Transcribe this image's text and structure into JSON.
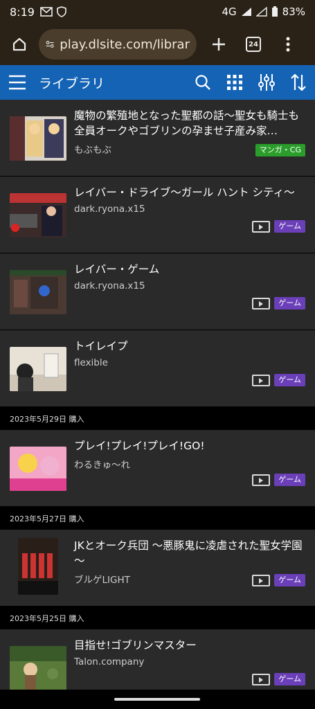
{
  "status": {
    "time": "8:19",
    "network": "4G",
    "battery": "83%"
  },
  "browser": {
    "url": "play.dlsite.com/librar",
    "tab_count": "24"
  },
  "appbar": {
    "title": "ライブラリ"
  },
  "items": [
    {
      "title": "魔物の繁殖地となった聖都の話～聖女も騎士も全員オークやゴブリンの孕ませ子産み家…",
      "author": "もぶもぶ",
      "tag": "マンガ・CG",
      "tag_type": "manga",
      "has_pc": false
    },
    {
      "title": "レイバー・ドライブ～ガール ハント シティ～",
      "author": "dark.ryona.x15",
      "tag": "ゲーム",
      "tag_type": "game",
      "has_pc": true
    },
    {
      "title": "レイバー・ゲーム",
      "author": "dark.ryona.x15",
      "tag": "ゲーム",
      "tag_type": "game",
      "has_pc": true
    },
    {
      "title": "トイレイプ",
      "author": "flexible",
      "tag": "ゲーム",
      "tag_type": "game",
      "has_pc": true
    },
    {
      "title": "プレイ!プレイ!プレイ!GO!",
      "author": "わるきゅ～れ",
      "tag": "ゲーム",
      "tag_type": "game",
      "has_pc": true
    },
    {
      "title": "JKとオーク兵団 ～悪豚鬼に凌虐された聖女学園～",
      "author": "ブルゲLIGHT",
      "tag": "ゲーム",
      "tag_type": "game",
      "has_pc": true
    },
    {
      "title": "目指せ!ゴブリンマスター",
      "author": "Talon.company",
      "tag": "ゲーム",
      "tag_type": "game",
      "has_pc": true
    }
  ],
  "dates": [
    "2023年5月29日 購入",
    "2023年5月27日 購入",
    "2023年5月25日 購入"
  ],
  "colors": {
    "accent": "#1463b5",
    "game_tag": "#6a3fb8",
    "manga_tag": "#2b9d2b",
    "row_bg": "#2a2a2a"
  }
}
